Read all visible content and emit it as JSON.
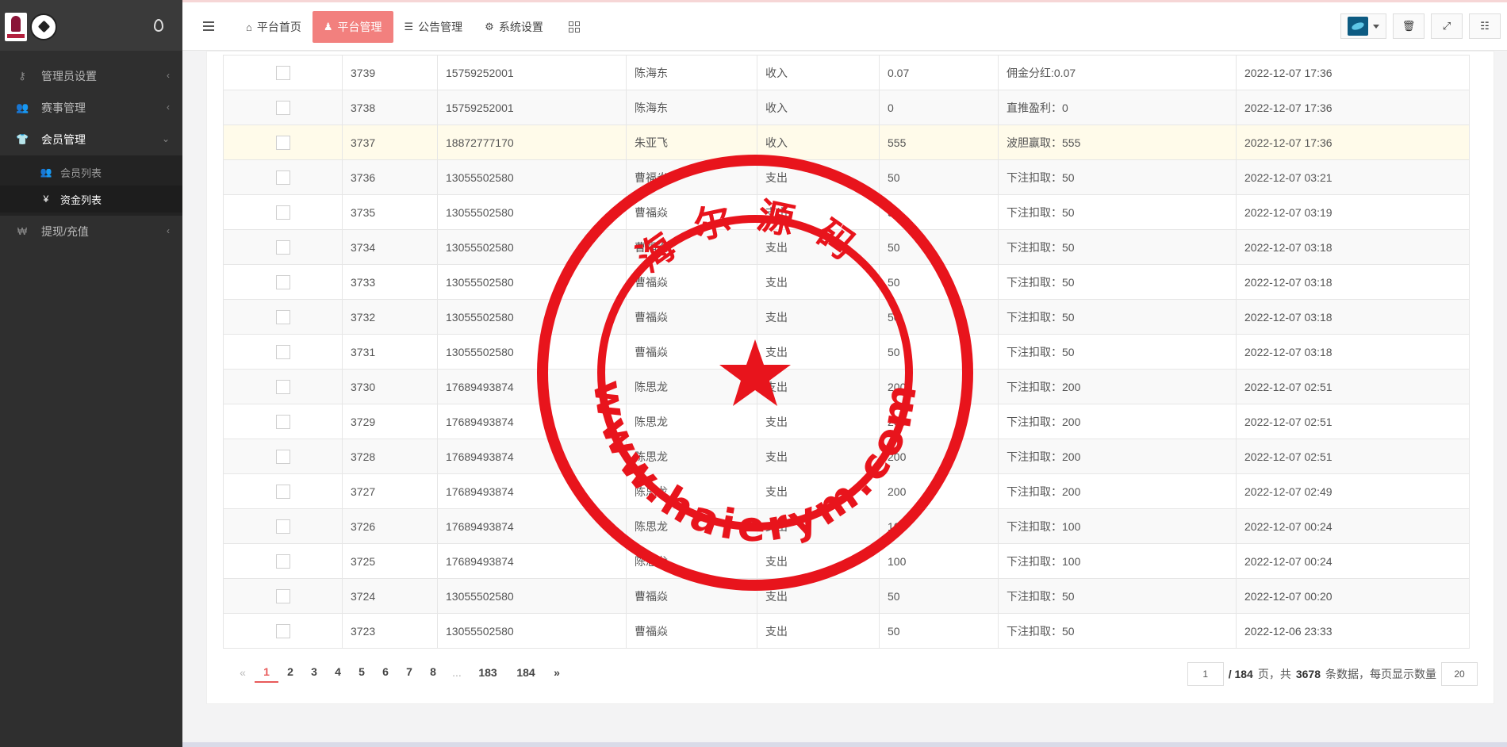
{
  "sidebar": {
    "items": [
      {
        "label": "管理员设置",
        "icon": "key-icon",
        "active": false
      },
      {
        "label": "赛事管理",
        "icon": "users-icon",
        "active": false
      },
      {
        "label": "会员管理",
        "icon": "shirt-icon",
        "active": true
      },
      {
        "label": "提现/充值",
        "icon": "currency-icon",
        "active": false
      }
    ],
    "submenu": [
      {
        "label": "会员列表",
        "icon": "users-icon",
        "active": false
      },
      {
        "label": "资金列表",
        "icon": "yen-icon",
        "active": true
      }
    ]
  },
  "topnav": {
    "tabs": [
      {
        "label": "平台首页",
        "icon": "home-icon"
      },
      {
        "label": "平台管理",
        "icon": "user-icon"
      },
      {
        "label": "公告管理",
        "icon": "list-icon"
      },
      {
        "label": "系统设置",
        "icon": "gear-icon"
      }
    ],
    "active_index": 1
  },
  "rows": [
    {
      "id": "3739",
      "phone": "15759252001",
      "name": "陈海东",
      "type": "收入",
      "amount": "0.07",
      "note": "佣金分红:0.07",
      "time": "2022-12-07 17:36"
    },
    {
      "id": "3738",
      "phone": "15759252001",
      "name": "陈海东",
      "type": "收入",
      "amount": "0",
      "note": "直推盈利：0",
      "time": "2022-12-07 17:36"
    },
    {
      "id": "3737",
      "phone": "18872777170",
      "name": "朱亚飞",
      "type": "收入",
      "amount": "555",
      "note": "波胆赢取：555",
      "time": "2022-12-07 17:36"
    },
    {
      "id": "3736",
      "phone": "13055502580",
      "name": "曹福焱",
      "type": "支出",
      "amount": "50",
      "note": "下注扣取：50",
      "time": "2022-12-07 03:21"
    },
    {
      "id": "3735",
      "phone": "13055502580",
      "name": "曹福焱",
      "type": "支出",
      "amount": "50",
      "note": "下注扣取：50",
      "time": "2022-12-07 03:19"
    },
    {
      "id": "3734",
      "phone": "13055502580",
      "name": "曹福焱",
      "type": "支出",
      "amount": "50",
      "note": "下注扣取：50",
      "time": "2022-12-07 03:18"
    },
    {
      "id": "3733",
      "phone": "13055502580",
      "name": "曹福焱",
      "type": "支出",
      "amount": "50",
      "note": "下注扣取：50",
      "time": "2022-12-07 03:18"
    },
    {
      "id": "3732",
      "phone": "13055502580",
      "name": "曹福焱",
      "type": "支出",
      "amount": "50",
      "note": "下注扣取：50",
      "time": "2022-12-07 03:18"
    },
    {
      "id": "3731",
      "phone": "13055502580",
      "name": "曹福焱",
      "type": "支出",
      "amount": "50",
      "note": "下注扣取：50",
      "time": "2022-12-07 03:18"
    },
    {
      "id": "3730",
      "phone": "17689493874",
      "name": "陈思龙",
      "type": "支出",
      "amount": "200",
      "note": "下注扣取：200",
      "time": "2022-12-07 02:51"
    },
    {
      "id": "3729",
      "phone": "17689493874",
      "name": "陈思龙",
      "type": "支出",
      "amount": "200",
      "note": "下注扣取：200",
      "time": "2022-12-07 02:51"
    },
    {
      "id": "3728",
      "phone": "17689493874",
      "name": "陈思龙",
      "type": "支出",
      "amount": "200",
      "note": "下注扣取：200",
      "time": "2022-12-07 02:51"
    },
    {
      "id": "3727",
      "phone": "17689493874",
      "name": "陈思龙",
      "type": "支出",
      "amount": "200",
      "note": "下注扣取：200",
      "time": "2022-12-07 02:49"
    },
    {
      "id": "3726",
      "phone": "17689493874",
      "name": "陈思龙",
      "type": "支出",
      "amount": "100",
      "note": "下注扣取：100",
      "time": "2022-12-07 00:24"
    },
    {
      "id": "3725",
      "phone": "17689493874",
      "name": "陈思龙",
      "type": "支出",
      "amount": "100",
      "note": "下注扣取：100",
      "time": "2022-12-07 00:24"
    },
    {
      "id": "3724",
      "phone": "13055502580",
      "name": "曹福焱",
      "type": "支出",
      "amount": "50",
      "note": "下注扣取：50",
      "time": "2022-12-07 00:20"
    },
    {
      "id": "3723",
      "phone": "13055502580",
      "name": "曹福焱",
      "type": "支出",
      "amount": "50",
      "note": "下注扣取：50",
      "time": "2022-12-06 23:33"
    }
  ],
  "pagination": {
    "prev": "«",
    "next": "»",
    "pages": [
      "1",
      "2",
      "3",
      "4",
      "5",
      "6",
      "7",
      "8"
    ],
    "ellipsis": "...",
    "tail_pages": [
      "183",
      "184"
    ],
    "current": "1",
    "input_value": "1",
    "total_pages_text": "/ 184",
    "page_unit": "页，共",
    "total_records": "3678",
    "records_text": "条数据，每页显示数量",
    "page_size": "20"
  },
  "stamp": {
    "top_text": "海尔源码",
    "bottom_text": "www.haierym.com",
    "color": "#e8141c"
  },
  "colors": {
    "accent": "#f2807e",
    "sidebar_bg": "#2f2f2f",
    "current_page": "#e85a5a"
  }
}
